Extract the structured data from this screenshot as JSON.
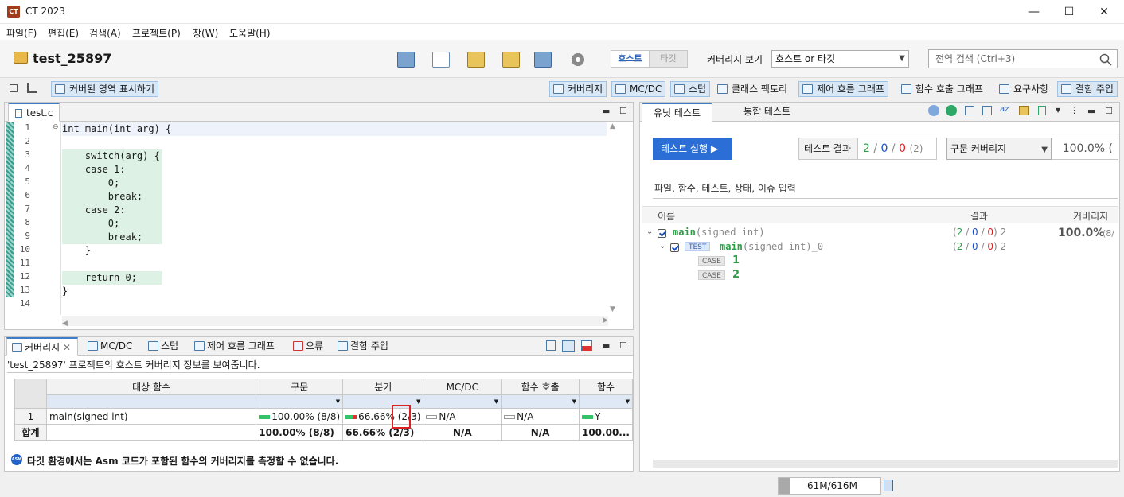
{
  "window": {
    "app_icon": "CT",
    "title": "CT 2023",
    "minimize": "—",
    "maximize": "☐",
    "close": "✕"
  },
  "menu": [
    "파일(F)",
    "편집(E)",
    "검색(A)",
    "프로젝트(P)",
    "창(W)",
    "도움말(H)"
  ],
  "toolbar": {
    "project": "test_25897",
    "host": "호스트",
    "target": "타깃",
    "coverage_view_label": "커버리지 보기",
    "coverage_view_value": "호스트 or 타깃",
    "search_placeholder": "전역 검색 (Ctrl+3)"
  },
  "viewbar": {
    "show_covered": "커버된 영역 표시하기",
    "items": [
      "커버리지",
      "MC/DC",
      "스텁",
      "클래스 팩토리",
      "제어 흐름 그래프",
      "함수 호출 그래프",
      "요구사항",
      "결함 주입"
    ]
  },
  "editor": {
    "tab": "test.c",
    "lines": [
      "int main(int arg) {",
      "",
      "    switch(arg) {",
      "    case 1:",
      "        0;",
      "        break;",
      "    case 2:",
      "        0;",
      "        break;",
      "    }",
      "",
      "    return 0;",
      "}",
      ""
    ]
  },
  "coverage": {
    "tabs": [
      "커버리지",
      "MC/DC",
      "스텁",
      "제어 흐름 그래프",
      "오류",
      "결함 주입"
    ],
    "info": "'test_25897' 프로젝트의 호스트 커버리지 정보를 보여줍니다.",
    "headers": [
      "대상 함수",
      "구문",
      "분기",
      "MC/DC",
      "함수 호출",
      "함수"
    ],
    "row": {
      "num": "1",
      "func": "main(signed int)",
      "stmt": "100.00% (8/8)",
      "branch_a": "66.66% (",
      "branch_b": "2/3)",
      "mcdc": "N/A",
      "call": "N/A",
      "func_cov": "Y"
    },
    "total": {
      "label": "합계",
      "stmt": "100.00% (8/8)",
      "branch": "66.66% (2/3)",
      "mcdc": "N/A",
      "call": "N/A",
      "func_cov": "100.00..."
    },
    "notice_icon": "ASM",
    "notice": "타깃 환경에서는 Asm 코드가 포함된 함수의 커버리지를 측정할 수 없습니다."
  },
  "unit": {
    "tabs": [
      "유닛 테스트",
      "통합 테스트"
    ],
    "run": "테스트 실행 ▶",
    "result_label": "테스트 결과",
    "pass": "2",
    "fail": "0",
    "err": "0",
    "total": "(2)",
    "sep": "/",
    "cov_type": "구문 커버리지",
    "cov_value": "100.0% (",
    "filter_placeholder": "파일, 함수, 테스트, 상태, 이슈 입력",
    "cols": [
      "이름",
      "결과",
      "커버리지"
    ],
    "tree": {
      "func": "main",
      "func_sig": "(signed int)",
      "test_tag": "TEST",
      "test": "main",
      "test_sig": "(signed int)_0",
      "case_tag": "CASE",
      "case1": "1",
      "case2": "2",
      "result_open": "(",
      "result_pass": "2",
      "result_fail": "0",
      "result_err": "0",
      "result_close": ") 2",
      "cov": "100.0%",
      "cov_tail": "(8/"
    }
  },
  "status": {
    "memory": "61M/616M"
  }
}
